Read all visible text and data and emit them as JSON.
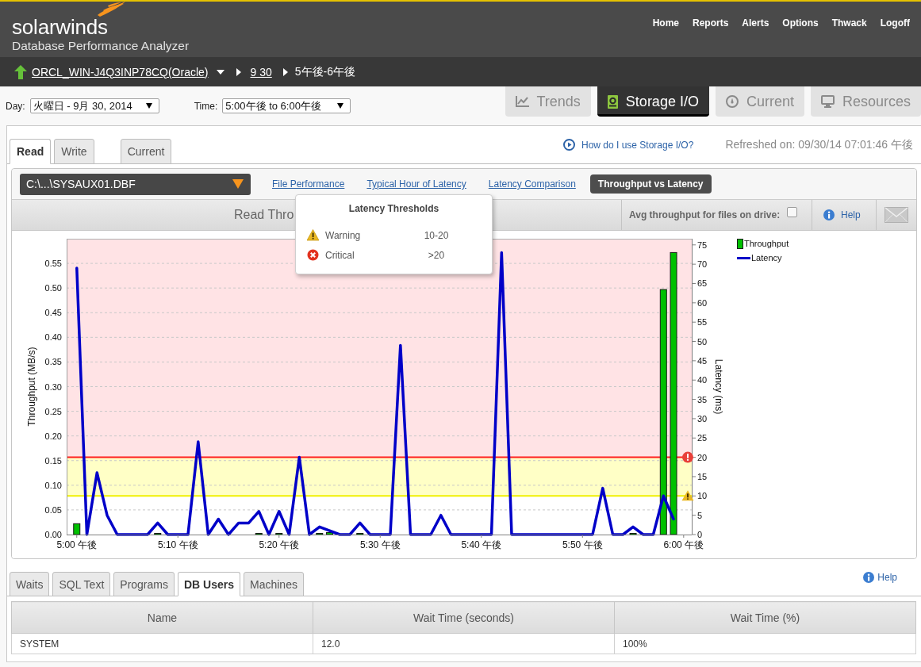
{
  "header": {
    "brand": "solarwinds",
    "product": "Database Performance Analyzer",
    "nav": [
      "Home",
      "Reports",
      "Alerts",
      "Options",
      "Thwack",
      "Logoff"
    ]
  },
  "breadcrumb": {
    "instance": "ORCL_WIN-J4Q3INP78CQ(Oracle)",
    "date": "9 30",
    "hour": "5午後-6午後"
  },
  "filters": [
    {
      "label": "Day:",
      "value": "火曜日 - 9月 30, 2014"
    },
    {
      "label": "Time:",
      "value": "5:00午後 to 6:00午後"
    }
  ],
  "view_tabs": [
    {
      "kind": "trends",
      "label": "Trends",
      "selected": false
    },
    {
      "kind": "storage",
      "label": "Storage I/O",
      "selected": true
    },
    {
      "kind": "current",
      "label": "Current",
      "selected": false
    },
    {
      "kind": "resources",
      "label": "Resources",
      "selected": false
    }
  ],
  "io_tabs": [
    {
      "label": "Read",
      "selected": true
    },
    {
      "label": "Write",
      "selected": false
    },
    {
      "label": "Current",
      "selected": false
    }
  ],
  "help_link": "How do I use Storage I/O?",
  "refreshed": "Refreshed on: 09/30/14 07:01:46 午後",
  "file_select": "C:\\...\\SYSAUX01.DBF",
  "chart_views": [
    {
      "label": "File Performance",
      "selected": false
    },
    {
      "label": "Typical Hour of Latency",
      "selected": false
    },
    {
      "label": "Latency Comparison",
      "selected": false
    },
    {
      "label": "Throughput vs Latency",
      "selected": true
    }
  ],
  "chart_panel": {
    "title": "Read Thro",
    "avg_toggle": {
      "label": "Avg throughput for files on drive:",
      "checked": false
    },
    "help": "Help",
    "chart_data": {
      "type": "bar",
      "ylabel": "Throughput (MB/s)",
      "y2label": "Latency (ms)",
      "categories": [
        "5:00 午後",
        null,
        null,
        null,
        null,
        null,
        null,
        null,
        null,
        null,
        "5:10 午後",
        null,
        null,
        null,
        null,
        null,
        null,
        null,
        null,
        null,
        "5:20 午後",
        null,
        null,
        null,
        null,
        null,
        null,
        null,
        null,
        null,
        "5:30 午後",
        null,
        null,
        null,
        null,
        null,
        null,
        null,
        null,
        null,
        "5:40 午後",
        null,
        null,
        null,
        null,
        null,
        null,
        null,
        null,
        null,
        "5:50 午後",
        null,
        null,
        null,
        null,
        null,
        null,
        null,
        null,
        null,
        "6:00 午後"
      ],
      "ylim": [
        0,
        0.6
      ],
      "yticks": [
        {
          "value": 0,
          "label": "0.00"
        },
        {
          "value": 0.05,
          "label": "0.05"
        },
        {
          "value": 0.1,
          "label": "0.10"
        },
        {
          "value": 0.15,
          "label": "0.15"
        },
        {
          "value": 0.2,
          "label": "0.20"
        },
        {
          "value": 0.25,
          "label": "0.25"
        },
        {
          "value": 0.3,
          "label": "0.30"
        },
        {
          "value": 0.35,
          "label": "0.35"
        },
        {
          "value": 0.4,
          "label": "0.40"
        },
        {
          "value": 0.45,
          "label": "0.45"
        },
        {
          "value": 0.5,
          "label": "0.50"
        },
        {
          "value": 0.55,
          "label": "0.55"
        }
      ],
      "y2lim": [
        0,
        76.6
      ],
      "y2ticks": [
        0,
        5,
        10,
        15,
        20,
        25,
        30,
        35,
        40,
        45,
        50,
        55,
        60,
        65,
        70,
        75
      ],
      "grid": true,
      "legend": true,
      "series": [
        {
          "name": "Throughput",
          "color": "#00c000",
          "values": [
            0.022,
            0,
            0,
            0,
            0,
            0,
            0,
            0,
            0.001,
            0,
            0,
            0,
            0,
            0,
            0,
            0,
            0,
            0,
            0.001,
            0,
            0.001,
            0,
            0,
            0,
            0.001,
            0.004,
            0,
            0,
            0.001,
            0,
            0,
            0,
            0,
            0,
            0,
            0,
            0,
            0,
            0,
            0,
            0,
            0,
            0,
            0,
            0,
            0,
            0,
            0,
            0,
            0,
            0,
            0,
            0,
            0,
            0,
            0.002,
            0,
            0,
            0.497,
            0.572,
            null
          ]
        },
        {
          "name": "Latency",
          "type": "line",
          "axis": "y2",
          "color": "#0000c8",
          "values": [
            69,
            0,
            16,
            5,
            0,
            0,
            0,
            0,
            3,
            0,
            0,
            0,
            24,
            0,
            4,
            0,
            3,
            3,
            6,
            0,
            6,
            0,
            20,
            0,
            2,
            1,
            0,
            0,
            3,
            0,
            0,
            0,
            49,
            0,
            0,
            0,
            5,
            0,
            0,
            0,
            0,
            0,
            73,
            0,
            0,
            0,
            0,
            0,
            0,
            0,
            0,
            0,
            12,
            0,
            0,
            2,
            0,
            0,
            10,
            4,
            null
          ]
        }
      ],
      "bands": [
        {
          "from": 10,
          "to": 20,
          "axis": "y2",
          "color": "#ffffc6"
        },
        {
          "from": 20,
          "to": 76.6,
          "axis": "y2",
          "color": "#ffe3e5"
        }
      ],
      "ref_lines": [
        {
          "value": 10,
          "axis": "y2",
          "color": "#f0f000"
        },
        {
          "value": 20,
          "axis": "y2",
          "color": "#ff2020"
        }
      ]
    }
  },
  "thresholds_popup": {
    "title": "Latency Thresholds",
    "rows": [
      {
        "kind": "warning",
        "label": "Warning",
        "range": "10-20"
      },
      {
        "kind": "critical",
        "label": "Critical",
        "range": ">20"
      }
    ]
  },
  "detail_tabs": [
    {
      "label": "Waits",
      "selected": false
    },
    {
      "label": "SQL Text",
      "selected": false
    },
    {
      "label": "Programs",
      "selected": false
    },
    {
      "label": "DB Users",
      "selected": true
    },
    {
      "label": "Machines",
      "selected": false
    }
  ],
  "detail_help": "Help",
  "table": {
    "columns": [
      "Name",
      "Wait Time (seconds)",
      "Wait Time (%)"
    ],
    "rows": [
      [
        "SYSTEM",
        "12.0",
        "100%"
      ]
    ]
  }
}
